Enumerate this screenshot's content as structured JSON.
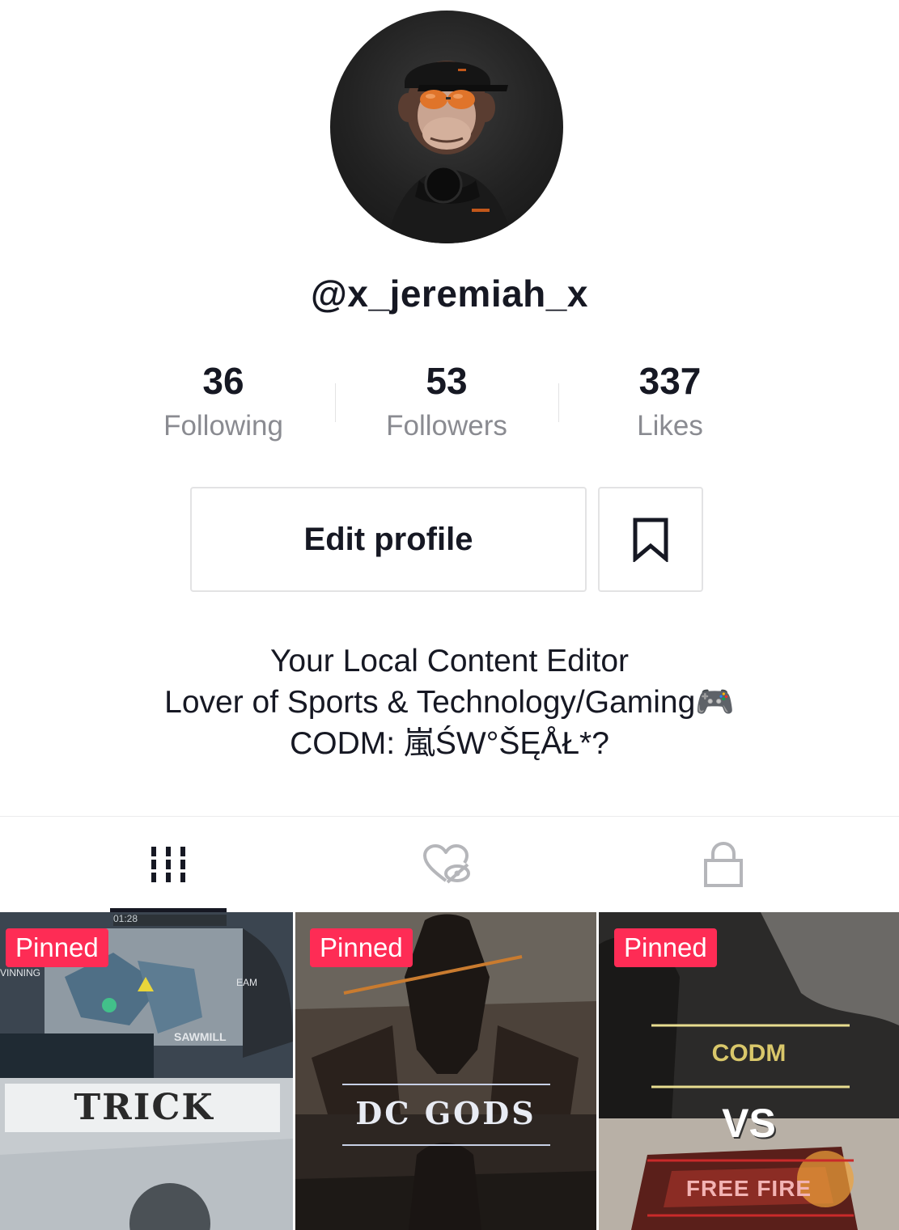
{
  "profile": {
    "username": "@x_jeremiah_x"
  },
  "stats": [
    {
      "value": "36",
      "label": "Following"
    },
    {
      "value": "53",
      "label": "Followers"
    },
    {
      "value": "337",
      "label": "Likes"
    }
  ],
  "actions": {
    "edit_label": "Edit profile",
    "bookmark_icon": "bookmark-icon"
  },
  "bio": {
    "line1": "Your Local Content Editor",
    "line2": "Lover of Sports & Technology/Gaming🎮",
    "line3": "CODM: 嵐ŚW°ŠĘÅŁ*?"
  },
  "tabs": [
    {
      "icon": "videos-grid-icon",
      "active": true
    },
    {
      "icon": "liked-hidden-icon",
      "active": false
    },
    {
      "icon": "lock-icon",
      "active": false
    }
  ],
  "videos": [
    {
      "badge": "Pinned",
      "caption": "TRICK",
      "hud_top": "01:28",
      "hud_left": "VINNING",
      "hud_map": "SAWMILL",
      "hud_team": "EAM"
    },
    {
      "badge": "Pinned",
      "caption": "DC GODS"
    },
    {
      "badge": "Pinned",
      "caption_top": "CODM",
      "caption_mid": "VS",
      "caption_bottom": "FREE FIRE"
    }
  ],
  "colors": {
    "accent": "#fe2c55",
    "text_primary": "#161823",
    "text_secondary": "#8a8b91",
    "border": "#e3e3e4"
  }
}
